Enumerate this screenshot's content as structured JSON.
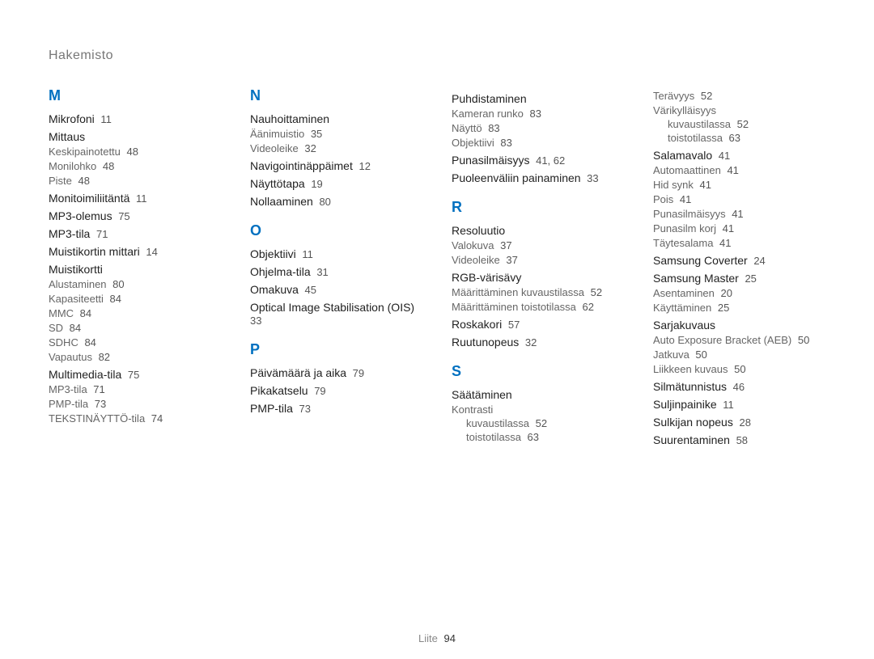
{
  "header": "Hakemisto",
  "footer": {
    "label": "Liite",
    "page": "94"
  },
  "columns": [
    {
      "sections": [
        {
          "letter": "M",
          "entries": [
            {
              "label": "Mikrofoni",
              "page": "11"
            },
            {
              "label": "Mittaus",
              "subs": [
                {
                  "label": "Keskipainotettu",
                  "page": "48"
                },
                {
                  "label": "Monilohko",
                  "page": "48"
                },
                {
                  "label": "Piste",
                  "page": "48"
                }
              ]
            },
            {
              "label": "Monitoimiliitäntä",
              "page": "11"
            },
            {
              "label": "MP3-olemus",
              "page": "75"
            },
            {
              "label": "MP3-tila",
              "page": "71"
            },
            {
              "label": "Muistikortin mittari",
              "page": "14"
            },
            {
              "label": "Muistikortti",
              "subs": [
                {
                  "label": "Alustaminen",
                  "page": "80"
                },
                {
                  "label": "Kapasiteetti",
                  "page": "84"
                },
                {
                  "label": "MMC",
                  "page": "84"
                },
                {
                  "label": "SD",
                  "page": "84"
                },
                {
                  "label": "SDHC",
                  "page": "84"
                },
                {
                  "label": "Vapautus",
                  "page": "82"
                }
              ]
            },
            {
              "label": "Multimedia-tila",
              "page": "75",
              "subs": [
                {
                  "label": "MP3-tila",
                  "page": "71"
                },
                {
                  "label": "PMP-tila",
                  "page": "73"
                },
                {
                  "label": "TEKSTINÄYTTÖ-tila",
                  "page": "74"
                }
              ]
            }
          ]
        }
      ]
    },
    {
      "sections": [
        {
          "letter": "N",
          "entries": [
            {
              "label": "Nauhoittaminen",
              "subs": [
                {
                  "label": "Äänimuistio",
                  "page": "35"
                },
                {
                  "label": "Videoleike",
                  "page": "32"
                }
              ]
            },
            {
              "label": "Navigointinäppäimet",
              "page": "12"
            },
            {
              "label": "Näyttötapa",
              "page": "19"
            },
            {
              "label": "Nollaaminen",
              "page": "80"
            }
          ]
        },
        {
          "letter": "O",
          "entries": [
            {
              "label": "Objektiivi",
              "page": "11"
            },
            {
              "label": "Ohjelma-tila",
              "page": "31"
            },
            {
              "label": "Omakuva",
              "page": "45"
            },
            {
              "label": "Optical Image Stabilisation (OIS)",
              "page": "33"
            }
          ]
        },
        {
          "letter": "P",
          "entries": [
            {
              "label": "Päivämäärä ja aika",
              "page": "79"
            },
            {
              "label": "Pikakatselu",
              "page": "79"
            },
            {
              "label": "PMP-tila",
              "page": "73"
            }
          ]
        }
      ]
    },
    {
      "sections": [
        {
          "entries": [
            {
              "label": "Puhdistaminen",
              "subs": [
                {
                  "label": "Kameran runko",
                  "page": "83"
                },
                {
                  "label": "Näyttö",
                  "page": "83"
                },
                {
                  "label": "Objektiivi",
                  "page": "83"
                }
              ]
            },
            {
              "label": "Punasilmäisyys",
              "page": "41, 62"
            },
            {
              "label": "Puoleenväliin painaminen",
              "page": "33"
            }
          ]
        },
        {
          "letter": "R",
          "entries": [
            {
              "label": "Resoluutio",
              "subs": [
                {
                  "label": "Valokuva",
                  "page": "37"
                },
                {
                  "label": "Videoleike",
                  "page": "37"
                }
              ]
            },
            {
              "label": "RGB-värisävy",
              "subs": [
                {
                  "label": "Määrittäminen kuvaustilassa",
                  "page": "52"
                },
                {
                  "label": "Määrittäminen toistotilassa",
                  "page": "62"
                }
              ]
            },
            {
              "label": "Roskakori",
              "page": "57"
            },
            {
              "label": "Ruutunopeus",
              "page": "32"
            }
          ]
        },
        {
          "letter": "S",
          "entries": [
            {
              "label": "Säätäminen",
              "subs": [
                {
                  "label": "Kontrasti",
                  "subs": [
                    {
                      "label": "kuvaustilassa",
                      "page": "52"
                    },
                    {
                      "label": "toistotilassa",
                      "page": "63"
                    }
                  ]
                }
              ]
            }
          ]
        }
      ]
    },
    {
      "sections": [
        {
          "entries": [
            {
              "label_sub_only": true,
              "subs": [
                {
                  "label": "Terävyys",
                  "page": "52"
                },
                {
                  "label": "Värikylläisyys",
                  "subs": [
                    {
                      "label": "kuvaustilassa",
                      "page": "52"
                    },
                    {
                      "label": "toistotilassa",
                      "page": "63"
                    }
                  ]
                }
              ]
            },
            {
              "label": "Salamavalo",
              "page": "41",
              "subs": [
                {
                  "label": "Automaattinen",
                  "page": "41"
                },
                {
                  "label": "Hid synk",
                  "page": "41"
                },
                {
                  "label": "Pois",
                  "page": "41"
                },
                {
                  "label": "Punasilmäisyys",
                  "page": "41"
                },
                {
                  "label": "Punasilm korj",
                  "page": "41"
                },
                {
                  "label": "Täytesalama",
                  "page": "41"
                }
              ]
            },
            {
              "label": "Samsung Coverter",
              "page": "24"
            },
            {
              "label": "Samsung Master",
              "page": "25",
              "subs": [
                {
                  "label": "Asentaminen",
                  "page": "20"
                },
                {
                  "label": "Käyttäminen",
                  "page": "25"
                }
              ]
            },
            {
              "label": "Sarjakuvaus",
              "subs": [
                {
                  "label": "Auto Exposure Bracket (AEB)",
                  "page": "50"
                },
                {
                  "label": "Jatkuva",
                  "page": "50"
                },
                {
                  "label": "Liikkeen kuvaus",
                  "page": "50"
                }
              ]
            },
            {
              "label": "Silmätunnistus",
              "page": "46"
            },
            {
              "label": "Suljinpainike",
              "page": "11"
            },
            {
              "label": "Sulkijan nopeus",
              "page": "28"
            },
            {
              "label": "Suurentaminen",
              "page": "58"
            }
          ]
        }
      ]
    }
  ]
}
